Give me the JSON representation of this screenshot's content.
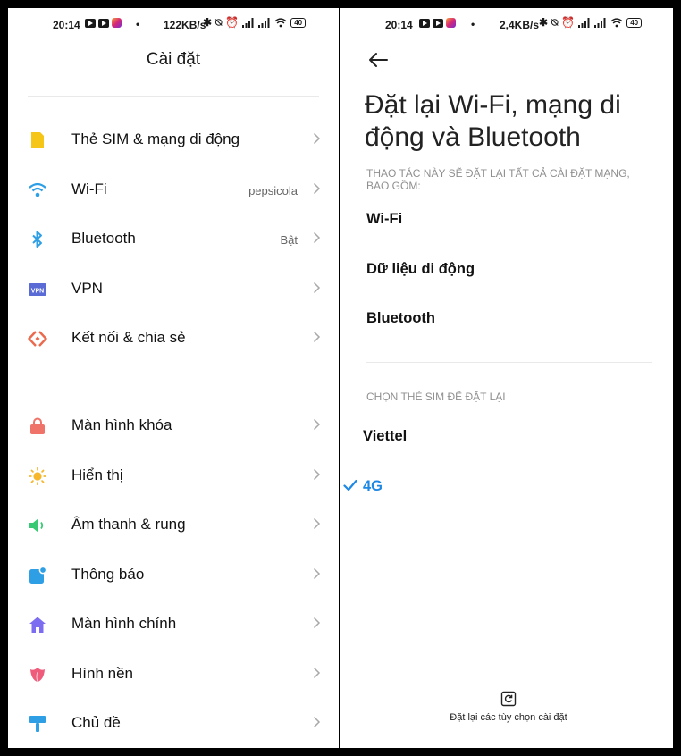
{
  "left": {
    "status": {
      "time": "20:14",
      "speed": "122KB/s",
      "battery": "40"
    },
    "title": "Cài đặt",
    "group1": [
      {
        "label": "Thẻ SIM & mạng di động",
        "value": "",
        "icon": "sim-card-icon",
        "color": "#f5c518"
      },
      {
        "label": "Wi-Fi",
        "value": "pepsicola",
        "icon": "wifi-icon",
        "color": "#2f9fe5"
      },
      {
        "label": "Bluetooth",
        "value": "Bật",
        "icon": "bluetooth-icon",
        "color": "#2f9fe5"
      },
      {
        "label": "VPN",
        "value": "",
        "icon": "vpn-icon",
        "color": "#5a6bd6"
      },
      {
        "label": "Kết nối & chia sẻ",
        "value": "",
        "icon": "share-icon",
        "color": "#ea6a4d"
      }
    ],
    "group2": [
      {
        "label": "Màn hình khóa",
        "value": "",
        "icon": "lock-icon",
        "color": "#f0736a"
      },
      {
        "label": "Hiển thị",
        "value": "",
        "icon": "sun-icon",
        "color": "#f6b72d"
      },
      {
        "label": "Âm thanh & rung",
        "value": "",
        "icon": "speaker-icon",
        "color": "#38c974"
      },
      {
        "label": "Thông báo",
        "value": "",
        "icon": "notification-icon",
        "color": "#2f9fe5"
      },
      {
        "label": "Màn hình chính",
        "value": "",
        "icon": "home-icon",
        "color": "#7b6cf0"
      },
      {
        "label": "Hình nền",
        "value": "",
        "icon": "tulip-icon",
        "color": "#ef5b7b"
      },
      {
        "label": "Chủ đề",
        "value": "",
        "icon": "brush-icon",
        "color": "#2f9fe5"
      }
    ]
  },
  "right": {
    "status": {
      "time": "20:14",
      "speed": "2,4KB/s",
      "battery": "40"
    },
    "title": "Đặt lại Wi-Fi, mạng di động và Bluetooth",
    "reset_section": "THAO TÁC NÀY SẼ ĐẶT LẠI TẤT CẢ CÀI ĐẶT MẠNG, BAO GỒM:",
    "reset_items": [
      "Wi-Fi",
      "Dữ liệu di động",
      "Bluetooth"
    ],
    "sim_section": "CHỌN THẺ SIM ĐỂ ĐẶT LẠI",
    "sims": [
      {
        "label": "Viettel",
        "selected": false
      },
      {
        "label": "4G",
        "selected": true
      }
    ],
    "footer_label": "Đặt lại các tùy chọn cài đặt"
  },
  "colors": {
    "accent": "#1e88e5",
    "divider": "#e9e9e9",
    "chevron": "#a8a8a8"
  }
}
